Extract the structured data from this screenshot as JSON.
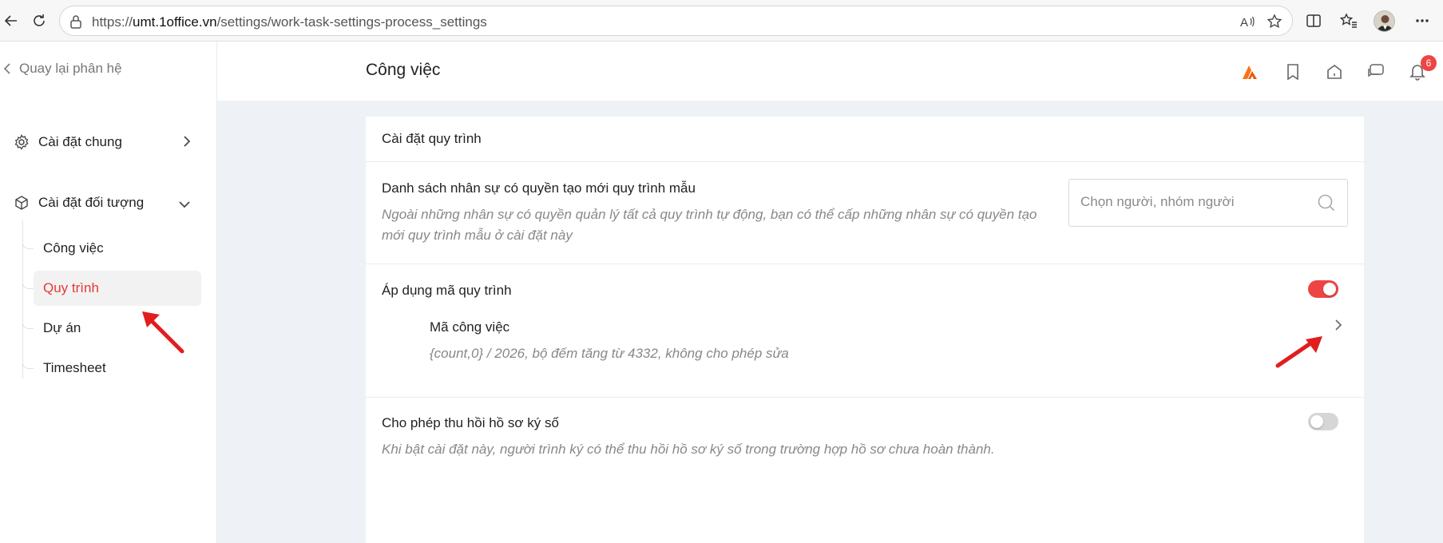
{
  "browser": {
    "url_prefix": "https://",
    "url_domain": "umt.1office.vn",
    "url_path": "/settings/work-task-settings-process_settings"
  },
  "sidebar": {
    "back_label": "Quay lại phân hệ",
    "groups": [
      {
        "label": "Cài đặt chung",
        "expanded": false
      },
      {
        "label": "Cài đặt đối tượng",
        "expanded": true
      }
    ],
    "sub_items": [
      {
        "label": "Công việc",
        "active": false
      },
      {
        "label": "Quy trình",
        "active": true
      },
      {
        "label": "Dự án",
        "active": false
      },
      {
        "label": "Timesheet",
        "active": false
      }
    ]
  },
  "header": {
    "title": "Công việc",
    "notification_count": "6"
  },
  "card": {
    "title": "Cài đặt quy trình",
    "settings": [
      {
        "label": "Danh sách nhân sự có quyền tạo mới quy trình mẫu",
        "description_line1": "Ngoài những nhân sự có quyền quản lý tất cả quy trình tự động, bạn có thể cấp những nhân sự có quyền tạo",
        "description_line2": "mới quy trình mẫu ở cài đặt này",
        "search_placeholder": "Chọn người, nhóm người"
      },
      {
        "label": "Áp dụng mã quy trình",
        "enabled": true,
        "sub_label": "Mã công việc",
        "sub_description": "{count,0} / 2026, bộ đếm tăng từ 4332, không cho phép sửa"
      },
      {
        "label": "Cho phép thu hồi hồ sơ ký số",
        "enabled": false,
        "description": "Khi bật cài đặt này, người trình ký có thể thu hồi hồ sơ ký số trong trường hợp hồ sơ chưa hoàn thành."
      }
    ]
  },
  "colors": {
    "accent": "#ef4444",
    "brand_logo": "#f97316",
    "content_bg": "#eef1f6"
  },
  "icons": [
    "back-arrow-icon",
    "refresh-icon",
    "lock-icon",
    "read-aloud-icon",
    "favorite-star-icon",
    "split-screen-icon",
    "favorites-list-icon",
    "more-icon",
    "chevron-left-icon",
    "gear-icon",
    "cube-icon",
    "chevron-right-icon",
    "chevron-down-icon",
    "brand-logo-icon",
    "bookmark-icon",
    "home-icon",
    "chat-icon",
    "bell-icon",
    "search-icon"
  ]
}
